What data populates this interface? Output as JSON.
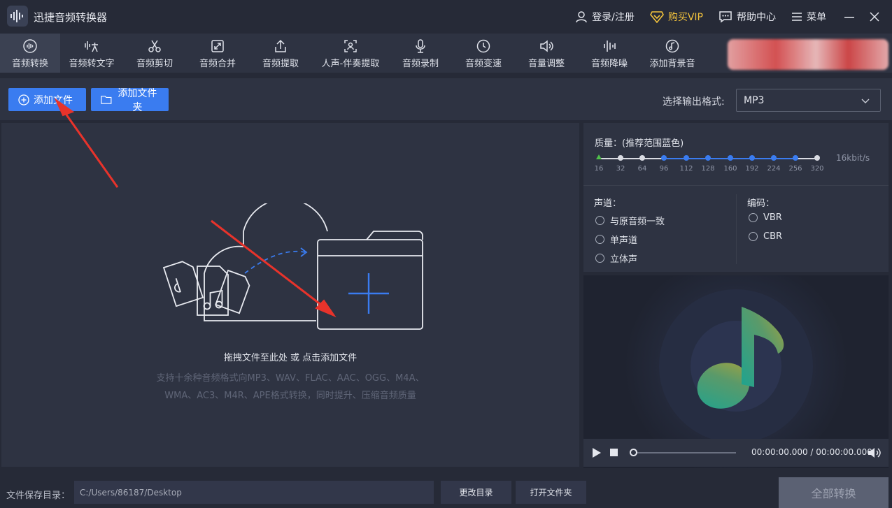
{
  "titlebar": {
    "app_title": "迅捷音频转换器",
    "login": "登录/注册",
    "vip": "购买VIP",
    "help": "帮助中心",
    "menu": "菜单",
    "vip_color": "#f3c33c"
  },
  "tabs": [
    {
      "label": "音频转换",
      "icon": "waveform-icon"
    },
    {
      "label": "音频转文字",
      "icon": "voice-to-text-icon"
    },
    {
      "label": "音频剪切",
      "icon": "scissors-icon"
    },
    {
      "label": "音频合并",
      "icon": "merge-icon"
    },
    {
      "label": "音频提取",
      "icon": "upload-icon"
    },
    {
      "label": "人声-伴奏提取",
      "icon": "scan-icon"
    },
    {
      "label": "音频录制",
      "icon": "microphone-icon"
    },
    {
      "label": "音频变速",
      "icon": "speed-icon"
    },
    {
      "label": "音量调整",
      "icon": "volume-icon"
    },
    {
      "label": "音频降噪",
      "icon": "denoise-icon"
    },
    {
      "label": "添加背景音",
      "icon": "music-note-icon"
    }
  ],
  "actions": {
    "add_file": "添加文件",
    "add_folder": "添加文件夹",
    "format_label": "选择输出格式:",
    "format_value": "MP3"
  },
  "drop": {
    "main": "拖拽文件至此处 或 点击添加文件",
    "sub_line1": "支持十余种音频格式向MP3、WAV、FLAC、AAC、OGG、M4A、",
    "sub_line2": "WMA、AC3、M4R、APE格式转换，同时提升、压缩音频质量"
  },
  "settings": {
    "quality_label": "质量：(推荐范围蓝色)",
    "quality_ticks": [
      "16",
      "32",
      "64",
      "96",
      "112",
      "128",
      "160",
      "192",
      "224",
      "256",
      "320"
    ],
    "quality_value": "16kbit/s",
    "channel_title": "声道：",
    "channel_options": [
      "与原音频一致",
      "单声道",
      "立体声"
    ],
    "encoding_title": "编码：",
    "encoding_options": [
      "VBR",
      "CBR"
    ],
    "accent_color": "#3a7cf0"
  },
  "player": {
    "time": "00:00:00.000 / 00:00:00.000"
  },
  "bottom": {
    "save_label": "文件保存目录：",
    "save_path": "C:/Users/86187/Desktop",
    "change_dir": "更改目录",
    "open_folder": "打开文件夹",
    "convert_all": "全部转换"
  }
}
